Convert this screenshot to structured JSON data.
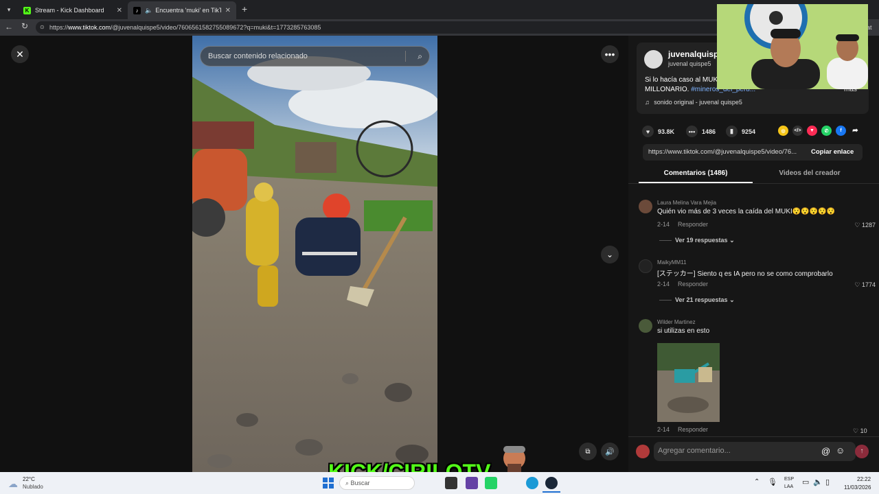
{
  "browser": {
    "tabs": [
      {
        "title": "Stream - Kick Dashboard",
        "favicon": "kick-icon",
        "active": false
      },
      {
        "title": "Encuentra 'muki' en TikTok | B",
        "favicon": "tiktok-icon",
        "active": true
      }
    ],
    "new_tab": "+",
    "url_prefix": "https://",
    "url_host": "www.tiktok.com",
    "url_path": "/@juvenalquispe5/video/7606561582755089672?q=muki&t=1773285763085",
    "extension_text": "at"
  },
  "video": {
    "search_placeholder": "Buscar contenido relacionado",
    "icons": [
      "close-icon",
      "more-icon",
      "chevron-down-icon",
      "pip-icon",
      "volume-icon"
    ]
  },
  "creator": {
    "handle": "juvenalquispe",
    "name": "juvenal quispe5",
    "caption_line1": "Si lo hacía caso al MUKI",
    "caption_line2_prefix": "MILLONARIO.",
    "hashtag": "#mineros_del_peru...",
    "more": "más",
    "sound": "sonido original - juvenal quispe5"
  },
  "stats": {
    "likes": "93.8K",
    "comments": "1486",
    "saves": "9254"
  },
  "link": {
    "url": "https://www.tiktok.com/@juvenalquispe5/video/76...",
    "copy_label": "Copiar enlace"
  },
  "tabs": {
    "comments": "Comentarios (1486)",
    "creator_videos": "Videos del creador"
  },
  "comments": [
    {
      "user": "Laura Melina Vara Mejia",
      "text": "Quién vio más de 3 veces la caída del MUKI",
      "emoji": "😯😯😯😯😯",
      "date": "2-14",
      "reply": "Responder",
      "likes": "1287",
      "view_replies": "Ver 19 respuestas",
      "avatar_color": "#6b4a3a"
    },
    {
      "user": "MaikyMM11",
      "text": "[ステッカー] Siento q es IA pero no se como comprobarlo",
      "date": "2-14",
      "reply": "Responder",
      "likes": "1774",
      "view_replies": "Ver 21 respuestas",
      "avatar_color": "#222222"
    },
    {
      "user": "Wilder Martinez",
      "text": "si utilizas en esto",
      "date": "2-14",
      "reply": "Responder",
      "likes": "10",
      "avatar_color": "#4a5a3a"
    }
  ],
  "comment_input": {
    "placeholder": "Agregar comentario..."
  },
  "overlay": {
    "kick_logo_text": "KICK/CIRILOTV"
  },
  "taskbar": {
    "weather_temp": "22°C",
    "weather_desc": "Nublado",
    "search_placeholder": "Buscar",
    "lang_line1": "ESP",
    "lang_line2": "LAA",
    "time": "22:22",
    "date": "11/03/2026"
  },
  "colors": {
    "accent": "#fe2c55",
    "hashtag": "#7fb3ff",
    "kick_green": "#53fc18"
  }
}
